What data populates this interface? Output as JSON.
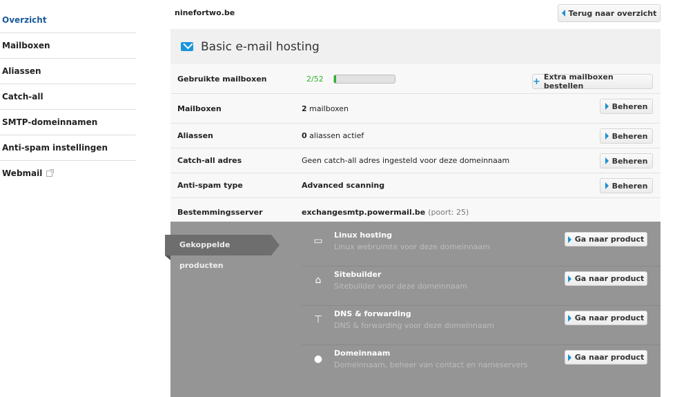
{
  "sidebar": {
    "items": [
      {
        "label": "Overzicht"
      },
      {
        "label": "Mailboxen"
      },
      {
        "label": "Aliassen"
      },
      {
        "label": "Catch-all"
      },
      {
        "label": "SMTP-domeinnamen"
      },
      {
        "label": "Anti-spam instellingen"
      },
      {
        "label": "Webmail"
      }
    ]
  },
  "header": {
    "domain": "ninefortwo.be",
    "back_label": "Terug naar overzicht"
  },
  "title": "Basic e-mail hosting",
  "usage": {
    "label": "Gebruikte mailboxen",
    "value": "2/52",
    "fraction": 0.038,
    "order_label": "Extra mailboxen bestellen"
  },
  "rows": [
    {
      "label": "Mailboxen",
      "strong": "2",
      "text": " mailboxen",
      "button": "Beheren"
    },
    {
      "label": "Aliassen",
      "strong": "0",
      "text": " aliassen actief",
      "button": "Beheren"
    },
    {
      "label": "Catch-all adres",
      "text": "Geen catch-all adres ingesteld voor deze domeinnaam",
      "button": "Beheren"
    },
    {
      "label": "Anti-spam type",
      "strong": "Advanced scanning",
      "button": "Beheren"
    },
    {
      "label": "Bestemmingsserver",
      "strong": "exchangesmtp.powermail.be",
      "muted": "(poort: 25)"
    }
  ],
  "linked": {
    "tab_label": "Gekoppelde producten",
    "products": [
      {
        "name": "Linux hosting",
        "desc": "Linux webruimte voor deze domeinnaam",
        "button": "Ga naar product",
        "icon": "server-icon"
      },
      {
        "name": "Sitebuilder",
        "desc": "Sitebuilder voor deze domeinnaam",
        "button": "Ga naar product",
        "icon": "home-icon"
      },
      {
        "name": "DNS & forwarding",
        "desc": "DNS & forwarding voor deze domeinnaam",
        "button": "Ga naar product",
        "icon": "signpost-icon"
      },
      {
        "name": "Domeinnaam",
        "desc": "Domeinnaam, beheer van contact en nameservers",
        "button": "Ga naar product",
        "icon": "globe-icon"
      }
    ]
  }
}
